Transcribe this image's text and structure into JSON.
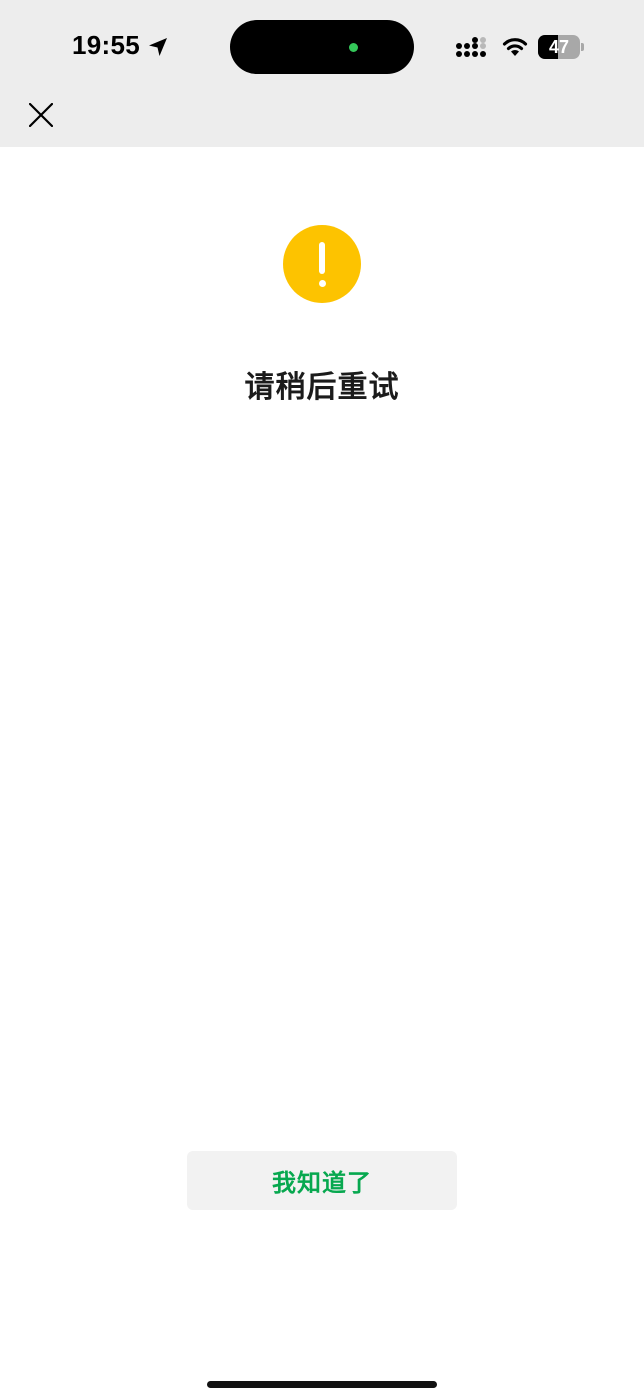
{
  "status_bar": {
    "time": "19:55",
    "battery_level": "47",
    "battery_fraction": 0.47,
    "icons": [
      "location-arrow-icon",
      "cellular-signal-icon",
      "wifi-icon",
      "battery-icon"
    ]
  },
  "nav": {
    "close_icon": "close-icon"
  },
  "alert": {
    "icon": "warning-icon",
    "icon_color": "#fdc300",
    "title": "请稍后重试"
  },
  "actions": {
    "ok_label": "我知道了",
    "ok_color": "#07a84f"
  }
}
